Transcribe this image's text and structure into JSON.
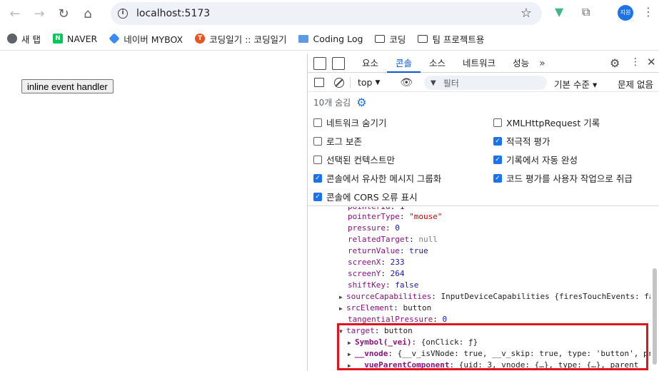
{
  "browser": {
    "url": "localhost:5173",
    "avatar_label": "지원",
    "bookmarks": [
      {
        "label": "새 탭",
        "icon": "globe-icon"
      },
      {
        "label": "NAVER",
        "icon": "naver-icon"
      },
      {
        "label": "네이버 MYBOX",
        "icon": "mybox-icon"
      },
      {
        "label": "코딩일기 :: 코딩일기",
        "icon": "tistory-icon"
      },
      {
        "label": "Coding Log",
        "icon": "monitor-icon"
      },
      {
        "label": "코딩",
        "icon": "folder-icon"
      },
      {
        "label": "팀 프로젝트용",
        "icon": "folder-icon"
      }
    ]
  },
  "page": {
    "button_label": "inline event handler"
  },
  "devtools": {
    "tabs": [
      "요소",
      "콘솔",
      "소스",
      "네트워크",
      "성능"
    ],
    "active_tab": "콘솔",
    "context": "top",
    "filter_placeholder": "필터",
    "level": "기본 수준 ▾",
    "issues": "문제 없음",
    "hidden_count": "10개 숨김",
    "settings": [
      {
        "label": "네트워크 숨기기",
        "checked": false
      },
      {
        "label": "XMLHttpRequest 기록",
        "checked": false
      },
      {
        "label": "로그 보존",
        "checked": false
      },
      {
        "label": "적극적 평가",
        "checked": true
      },
      {
        "label": "선택된 컨텍스트만",
        "checked": false
      },
      {
        "label": "기록에서 자동 완성",
        "checked": true
      },
      {
        "label": "콘솔에서 유사한 메시지 그룹화",
        "checked": true
      },
      {
        "label": "코드 평가를 사용자 작업으로 취급",
        "checked": true
      },
      {
        "label": "콘솔에 CORS 오류 표시",
        "checked": true
      }
    ],
    "console_lines": [
      {
        "key": "pointerType",
        "value": "\"mouse\""
      },
      {
        "key": "pressure",
        "value": "0"
      },
      {
        "key": "relatedTarget",
        "value": "null"
      },
      {
        "key": "returnValue",
        "value": "true"
      },
      {
        "key": "screenX",
        "value": "233"
      },
      {
        "key": "screenY",
        "value": "264"
      },
      {
        "key": "shiftKey",
        "value": "false"
      },
      {
        "key": "sourceCapabilities",
        "value": "InputDeviceCapabilities {firesTouchEvents: false"
      },
      {
        "key": "srcElement",
        "value": "button"
      },
      {
        "key": "tangentialPressure",
        "value": "0"
      },
      {
        "key": "target",
        "value": "button"
      },
      {
        "key": "Symbol(_vei)",
        "value": "{onClick: ƒ}"
      },
      {
        "key": "__vnode",
        "value": "{__v_isVNode: true, __v_skip: true, type: 'button', prop"
      },
      {
        "key": "__vueParentComponent",
        "value": "{uid: 3, vnode: {…}, type: {…}, parent"
      }
    ]
  },
  "colors": {
    "accent": "#0b57d0",
    "highlight_border": "#e0141e"
  }
}
